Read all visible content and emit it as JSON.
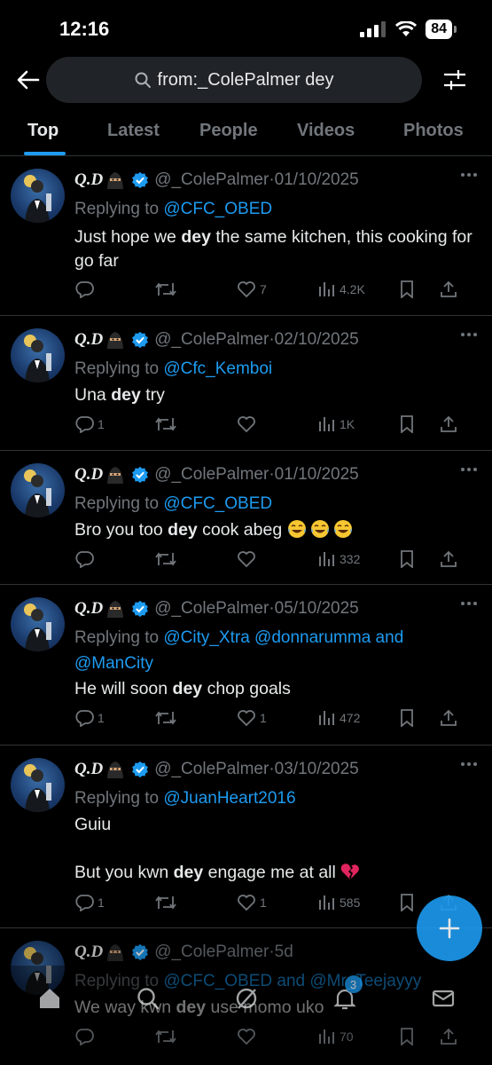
{
  "status": {
    "time": "12:16",
    "battery": "84"
  },
  "search": {
    "query": "from:_ColePalmer dey"
  },
  "tabs": [
    {
      "label": "Top"
    },
    {
      "label": "Latest"
    },
    {
      "label": "People"
    },
    {
      "label": "Videos"
    },
    {
      "label": "Photos"
    }
  ],
  "tweets": [
    {
      "name": "Q.D",
      "handle": "@_ColePalmer",
      "sep": "·",
      "date": "01/10/2025",
      "replying_prefix": "Replying to ",
      "mentions": "@CFC_OBED",
      "body_before": "Just hope we ",
      "body_bold": "dey",
      "body_after": " the same kitchen, this cooking for go far",
      "replies": "",
      "likes": "7",
      "views": "4.2K"
    },
    {
      "name": "Q.D",
      "handle": "@_ColePalmer",
      "sep": "·",
      "date": "02/10/2025",
      "replying_prefix": "Replying to ",
      "mentions": "@Cfc_Kemboi",
      "body_before": "Una ",
      "body_bold": "dey",
      "body_after": " try",
      "replies": "1",
      "likes": "",
      "views": "1K"
    },
    {
      "name": "Q.D",
      "handle": "@_ColePalmer",
      "sep": "·",
      "date": "01/10/2025",
      "replying_prefix": "Replying to ",
      "mentions": "@CFC_OBED",
      "body_before": "Bro you too ",
      "body_bold": "dey",
      "body_after": " cook abeg ",
      "replies": "",
      "likes": "",
      "views": "332"
    },
    {
      "name": "Q.D",
      "handle": "@_ColePalmer",
      "sep": "·",
      "date": "05/10/2025",
      "replying_prefix": "Replying to ",
      "mentions": "@City_Xtra @donnarumma and @ManCity",
      "body_before": "He will soon ",
      "body_bold": "dey",
      "body_after": " chop goals",
      "replies": "1",
      "likes": "1",
      "views": "472"
    },
    {
      "name": "Q.D",
      "handle": "@_ColePalmer",
      "sep": "·",
      "date": "03/10/2025",
      "replying_prefix": "Replying to ",
      "mentions": "@JuanHeart2016",
      "body_line1": "Guiu",
      "body_before": "But you kwn ",
      "body_bold": "dey",
      "body_after": " engage me at all ",
      "replies": "1",
      "likes": "1",
      "views": "585"
    },
    {
      "name": "Q.D",
      "handle": "@_ColePalmer",
      "sep": "·",
      "date": "5d",
      "replying_prefix": "Replying to ",
      "mentions": "@CFC_OBED and @Mr_Teejayyy",
      "body_before": "We way kwn ",
      "body_bold": "dey",
      "body_after": " use momo uko",
      "replies": "",
      "likes": "",
      "views": "70"
    }
  ],
  "nav": {
    "notifications_count": "3"
  },
  "colors": {
    "accent": "#1d9bf0",
    "muted": "#71767b",
    "background": "#000000"
  }
}
